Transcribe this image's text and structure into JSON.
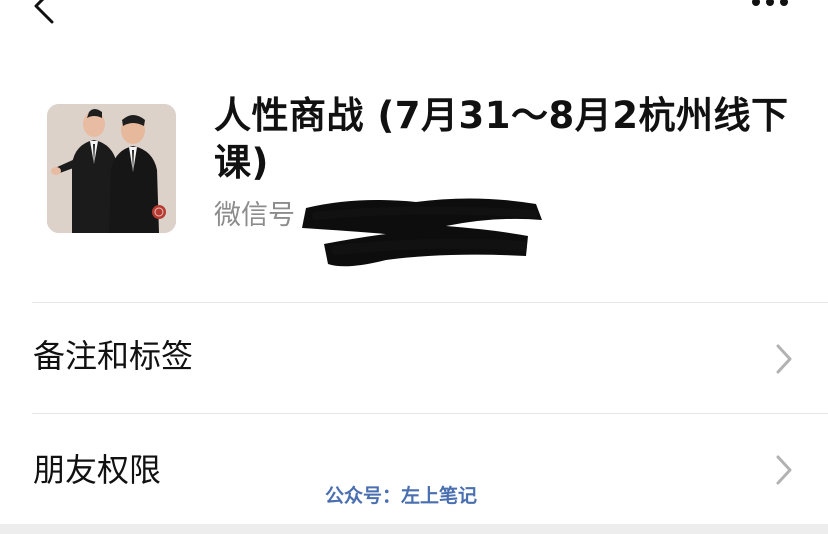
{
  "header": {
    "back_icon": "chevron-left-icon",
    "more_icon": "more-dots-icon"
  },
  "profile": {
    "name": "人性商战 (7月31～8月2杭州线下课)",
    "wechat_id_label": "微信号"
  },
  "menu": {
    "items": [
      {
        "label": "备注和标签",
        "icon": "chevron-right-icon"
      },
      {
        "label": "朋友权限",
        "icon": "chevron-right-icon"
      }
    ]
  },
  "watermark": {
    "text": "公众号：左上笔记"
  },
  "colors": {
    "text_primary": "#111111",
    "text_secondary": "#8c8c8c",
    "divider": "#e6e6e6",
    "chevron": "#b2b2b2",
    "watermark": "#4a6fb0",
    "bottom_band": "#ededed"
  }
}
